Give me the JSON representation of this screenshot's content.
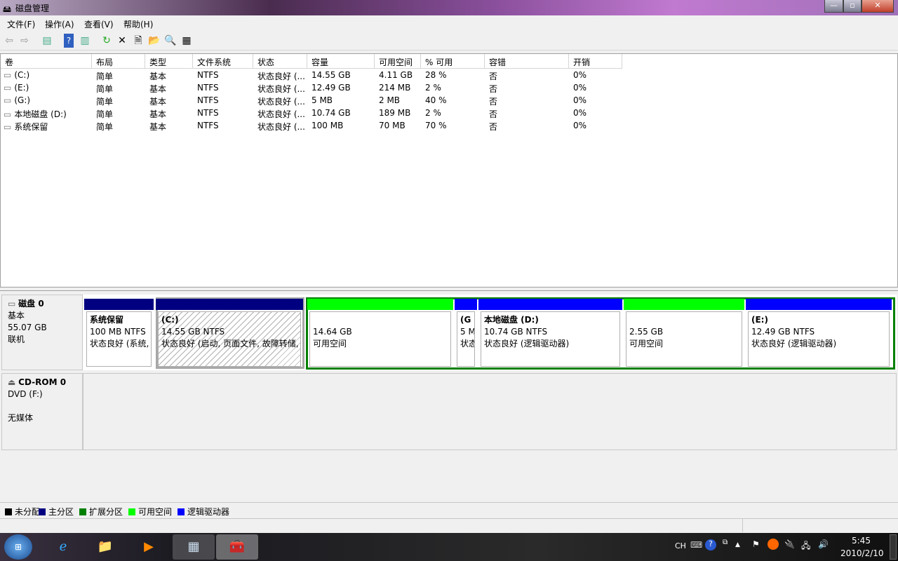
{
  "window": {
    "title": "磁盘管理",
    "min": "—",
    "max": "▫",
    "close": "✕"
  },
  "menu": [
    "文件(F)",
    "操作(A)",
    "查看(V)",
    "帮助(H)"
  ],
  "columns": [
    "卷",
    "布局",
    "类型",
    "文件系统",
    "状态",
    "容量",
    "可用空间",
    "% 可用",
    "容错",
    "开销"
  ],
  "rows": [
    [
      "(C:)",
      "简单",
      "基本",
      "NTFS",
      "状态良好 (...",
      "14.55 GB",
      "4.11 GB",
      "28 %",
      "否",
      "0%"
    ],
    [
      "(E:)",
      "简单",
      "基本",
      "NTFS",
      "状态良好 (...",
      "12.49 GB",
      "214 MB",
      "2 %",
      "否",
      "0%"
    ],
    [
      "(G:)",
      "简单",
      "基本",
      "NTFS",
      "状态良好 (...",
      "5 MB",
      "2 MB",
      "40 %",
      "否",
      "0%"
    ],
    [
      "本地磁盘 (D:)",
      "简单",
      "基本",
      "NTFS",
      "状态良好 (...",
      "10.74 GB",
      "189 MB",
      "2 %",
      "否",
      "0%"
    ],
    [
      "系统保留",
      "简单",
      "基本",
      "NTFS",
      "状态良好 (...",
      "100 MB",
      "70 MB",
      "70 %",
      "否",
      "0%"
    ]
  ],
  "disk0": {
    "name": "磁盘 0",
    "type": "基本",
    "size": "55.07 GB",
    "state": "联机"
  },
  "partitions": [
    {
      "name": "系统保留",
      "size": "100 MB NTFS",
      "status": "状态良好 (系统,"
    },
    {
      "name": "(C:)",
      "size": "14.55 GB NTFS",
      "status": "状态良好 (启动, 页面文件, 故障转储,"
    },
    {
      "name": "",
      "size": "14.64 GB",
      "status": "可用空间"
    },
    {
      "name": "(G",
      "size": "5 M",
      "status": "状态"
    },
    {
      "name": "本地磁盘  (D:)",
      "size": "10.74 GB NTFS",
      "status": "状态良好 (逻辑驱动器)"
    },
    {
      "name": "",
      "size": "2.55 GB",
      "status": "可用空间"
    },
    {
      "name": "(E:)",
      "size": "12.49 GB NTFS",
      "status": "状态良好 (逻辑驱动器)"
    }
  ],
  "cdrom": {
    "name": "CD-ROM 0",
    "type": "DVD (F:)",
    "state": "无媒体"
  },
  "legend": [
    {
      "label": "未分配",
      "color": "#000000"
    },
    {
      "label": "主分区",
      "color": "#000080"
    },
    {
      "label": "扩展分区",
      "color": "#008000"
    },
    {
      "label": "可用空间",
      "color": "#00ff00"
    },
    {
      "label": "逻辑驱动器",
      "color": "#0000ff"
    }
  ],
  "tray": {
    "lang": "CH",
    "time": "5:45",
    "date": "2010/2/10"
  }
}
